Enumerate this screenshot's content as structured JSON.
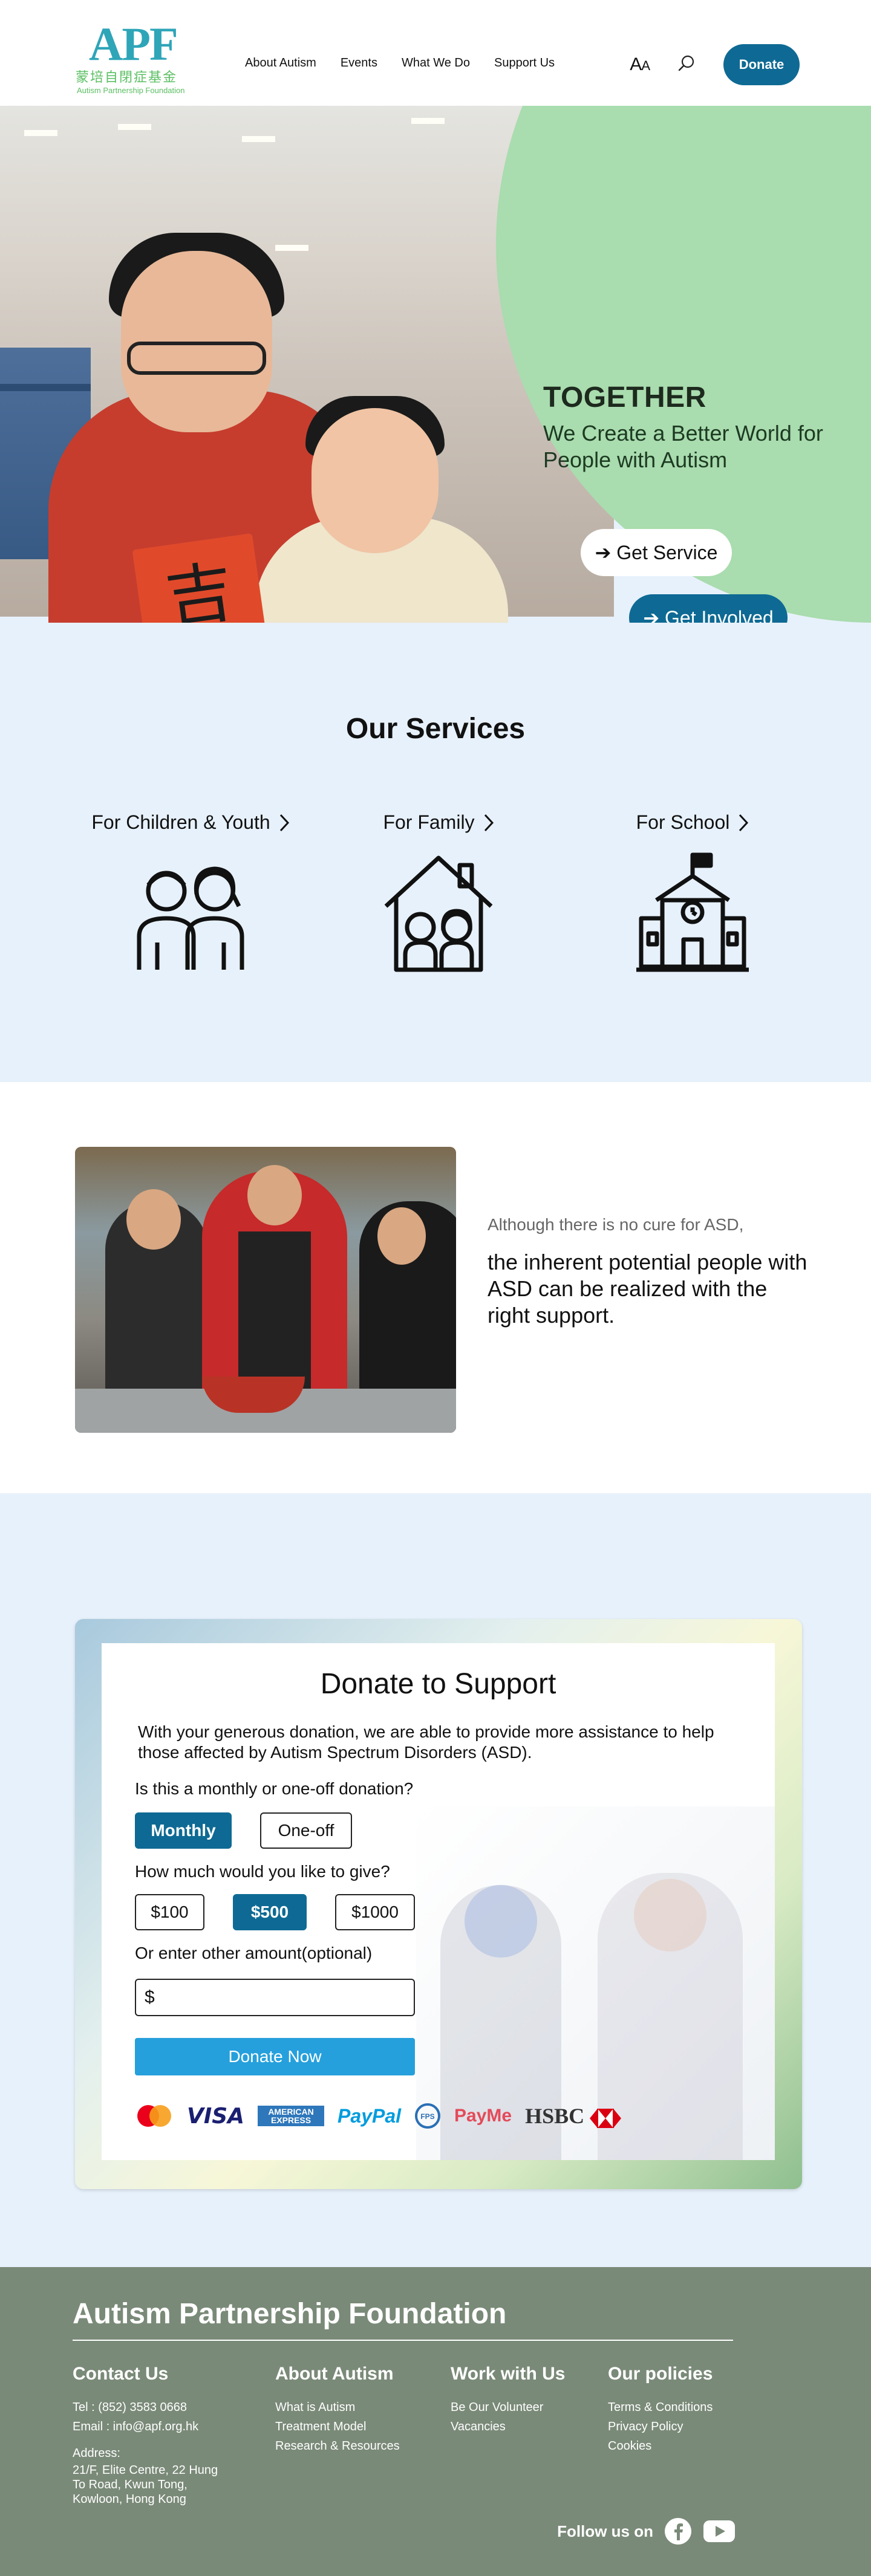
{
  "header": {
    "logo_mark": "APF",
    "logo_cn": "蒙培自閉症基金",
    "logo_en": "Autism Partnership Foundation",
    "nav": [
      "About Autism",
      "Events",
      "What We Do",
      "Support Us"
    ],
    "font_size_label": "A",
    "font_size_label_small": "A",
    "donate_label": "Donate"
  },
  "hero": {
    "headline": "TOGETHER",
    "subline": "We Create a Better World for People with Autism",
    "cta_service": "➔ Get Service",
    "cta_involved": "➔ Get Involved",
    "paper_char": "吉"
  },
  "services": {
    "title": "Our Services",
    "items": [
      {
        "label": "For Children & Youth",
        "icon": "children-icon"
      },
      {
        "label": "For Family",
        "icon": "family-home-icon"
      },
      {
        "label": "For School",
        "icon": "school-icon"
      }
    ]
  },
  "asd": {
    "line1": "Although there is no cure for ASD,",
    "line2": "the inherent potential people with ASD can be realized with the right support."
  },
  "donate": {
    "title": "Donate to Support",
    "description": "With your generous donation, we are able to provide more assistance to help those affected by Autism Spectrum Disorders (ASD).",
    "frequency_question": "Is this a monthly or one-off donation?",
    "frequency_options": [
      "Monthly",
      "One-off"
    ],
    "frequency_selected": "Monthly",
    "amount_question": "How much would you like to give?",
    "amount_options": [
      "$100",
      "$500",
      "$1000"
    ],
    "amount_selected": "$500",
    "other_label": "Or enter other amount(optional)",
    "other_value": "$",
    "submit_label": "Donate Now",
    "payment_logos": [
      "Mastercard",
      "VISA",
      "AMERICAN EXPRESS",
      "PayPal",
      "FPS",
      "PayMe",
      "HSBC"
    ]
  },
  "footer": {
    "title": "Autism Partnership Foundation",
    "contact": {
      "heading": "Contact Us",
      "tel": "Tel : (852) 3583 0668",
      "email": "Email : info@apf.org.hk",
      "address_label": "Address:",
      "address_lines": [
        "21/F, Elite Centre, 22 Hung",
        "To Road, Kwun Tong,",
        "Kowloon, Hong Kong"
      ]
    },
    "about": {
      "heading": "About Autism",
      "links": [
        "What is Autism",
        "Treatment Model",
        "Research & Resources"
      ]
    },
    "work": {
      "heading": "Work with Us",
      "links": [
        "Be Our Volunteer",
        "Vacancies"
      ]
    },
    "policies": {
      "heading": "Our policies",
      "links": [
        "Terms & Conditions",
        "Privacy Policy",
        "Cookies"
      ]
    },
    "follow_label": "Follow us on"
  },
  "colors": {
    "brand_blue": "#0e6a94",
    "hero_green": "#a9dcae",
    "page_bg": "#e7f1fb",
    "footer_bg": "#7a8a78",
    "donate_now_blue": "#25a0dc"
  }
}
